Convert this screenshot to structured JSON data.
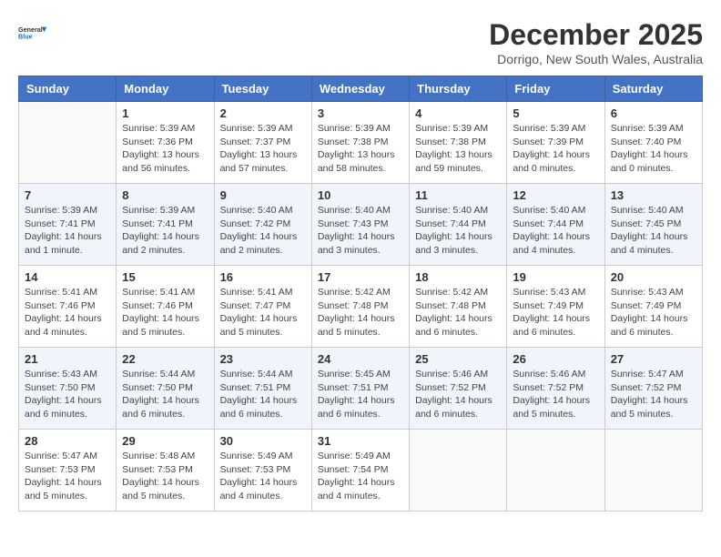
{
  "logo": {
    "line1": "General",
    "line2": "Blue"
  },
  "title": "December 2025",
  "subtitle": "Dorrigo, New South Wales, Australia",
  "days_of_week": [
    "Sunday",
    "Monday",
    "Tuesday",
    "Wednesday",
    "Thursday",
    "Friday",
    "Saturday"
  ],
  "weeks": [
    [
      {
        "day": "",
        "info": ""
      },
      {
        "day": "1",
        "info": "Sunrise: 5:39 AM\nSunset: 7:36 PM\nDaylight: 13 hours\nand 56 minutes."
      },
      {
        "day": "2",
        "info": "Sunrise: 5:39 AM\nSunset: 7:37 PM\nDaylight: 13 hours\nand 57 minutes."
      },
      {
        "day": "3",
        "info": "Sunrise: 5:39 AM\nSunset: 7:38 PM\nDaylight: 13 hours\nand 58 minutes."
      },
      {
        "day": "4",
        "info": "Sunrise: 5:39 AM\nSunset: 7:38 PM\nDaylight: 13 hours\nand 59 minutes."
      },
      {
        "day": "5",
        "info": "Sunrise: 5:39 AM\nSunset: 7:39 PM\nDaylight: 14 hours\nand 0 minutes."
      },
      {
        "day": "6",
        "info": "Sunrise: 5:39 AM\nSunset: 7:40 PM\nDaylight: 14 hours\nand 0 minutes."
      }
    ],
    [
      {
        "day": "7",
        "info": "Sunrise: 5:39 AM\nSunset: 7:41 PM\nDaylight: 14 hours\nand 1 minute."
      },
      {
        "day": "8",
        "info": "Sunrise: 5:39 AM\nSunset: 7:41 PM\nDaylight: 14 hours\nand 2 minutes."
      },
      {
        "day": "9",
        "info": "Sunrise: 5:40 AM\nSunset: 7:42 PM\nDaylight: 14 hours\nand 2 minutes."
      },
      {
        "day": "10",
        "info": "Sunrise: 5:40 AM\nSunset: 7:43 PM\nDaylight: 14 hours\nand 3 minutes."
      },
      {
        "day": "11",
        "info": "Sunrise: 5:40 AM\nSunset: 7:44 PM\nDaylight: 14 hours\nand 3 minutes."
      },
      {
        "day": "12",
        "info": "Sunrise: 5:40 AM\nSunset: 7:44 PM\nDaylight: 14 hours\nand 4 minutes."
      },
      {
        "day": "13",
        "info": "Sunrise: 5:40 AM\nSunset: 7:45 PM\nDaylight: 14 hours\nand 4 minutes."
      }
    ],
    [
      {
        "day": "14",
        "info": "Sunrise: 5:41 AM\nSunset: 7:46 PM\nDaylight: 14 hours\nand 4 minutes."
      },
      {
        "day": "15",
        "info": "Sunrise: 5:41 AM\nSunset: 7:46 PM\nDaylight: 14 hours\nand 5 minutes."
      },
      {
        "day": "16",
        "info": "Sunrise: 5:41 AM\nSunset: 7:47 PM\nDaylight: 14 hours\nand 5 minutes."
      },
      {
        "day": "17",
        "info": "Sunrise: 5:42 AM\nSunset: 7:48 PM\nDaylight: 14 hours\nand 5 minutes."
      },
      {
        "day": "18",
        "info": "Sunrise: 5:42 AM\nSunset: 7:48 PM\nDaylight: 14 hours\nand 6 minutes."
      },
      {
        "day": "19",
        "info": "Sunrise: 5:43 AM\nSunset: 7:49 PM\nDaylight: 14 hours\nand 6 minutes."
      },
      {
        "day": "20",
        "info": "Sunrise: 5:43 AM\nSunset: 7:49 PM\nDaylight: 14 hours\nand 6 minutes."
      }
    ],
    [
      {
        "day": "21",
        "info": "Sunrise: 5:43 AM\nSunset: 7:50 PM\nDaylight: 14 hours\nand 6 minutes."
      },
      {
        "day": "22",
        "info": "Sunrise: 5:44 AM\nSunset: 7:50 PM\nDaylight: 14 hours\nand 6 minutes."
      },
      {
        "day": "23",
        "info": "Sunrise: 5:44 AM\nSunset: 7:51 PM\nDaylight: 14 hours\nand 6 minutes."
      },
      {
        "day": "24",
        "info": "Sunrise: 5:45 AM\nSunset: 7:51 PM\nDaylight: 14 hours\nand 6 minutes."
      },
      {
        "day": "25",
        "info": "Sunrise: 5:46 AM\nSunset: 7:52 PM\nDaylight: 14 hours\nand 6 minutes."
      },
      {
        "day": "26",
        "info": "Sunrise: 5:46 AM\nSunset: 7:52 PM\nDaylight: 14 hours\nand 5 minutes."
      },
      {
        "day": "27",
        "info": "Sunrise: 5:47 AM\nSunset: 7:52 PM\nDaylight: 14 hours\nand 5 minutes."
      }
    ],
    [
      {
        "day": "28",
        "info": "Sunrise: 5:47 AM\nSunset: 7:53 PM\nDaylight: 14 hours\nand 5 minutes."
      },
      {
        "day": "29",
        "info": "Sunrise: 5:48 AM\nSunset: 7:53 PM\nDaylight: 14 hours\nand 5 minutes."
      },
      {
        "day": "30",
        "info": "Sunrise: 5:49 AM\nSunset: 7:53 PM\nDaylight: 14 hours\nand 4 minutes."
      },
      {
        "day": "31",
        "info": "Sunrise: 5:49 AM\nSunset: 7:54 PM\nDaylight: 14 hours\nand 4 minutes."
      },
      {
        "day": "",
        "info": ""
      },
      {
        "day": "",
        "info": ""
      },
      {
        "day": "",
        "info": ""
      }
    ]
  ]
}
